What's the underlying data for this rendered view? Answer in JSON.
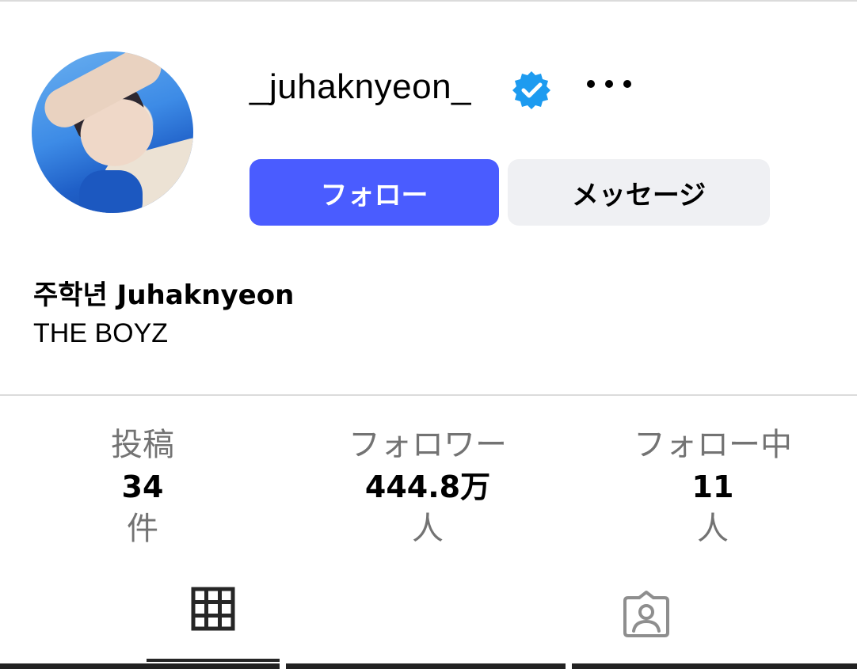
{
  "profile": {
    "username": "_juhaknyeon_",
    "display_name": "주학년 Juhaknyeon",
    "bio": "THE BOYZ"
  },
  "icons": {
    "verified": "verified-badge-icon",
    "more": "more-options-icon",
    "grid": "grid-icon",
    "tagged": "tagged-icon"
  },
  "actions": {
    "follow_label": "フォロー",
    "message_label": "メッセージ"
  },
  "stats": [
    {
      "label": "投稿",
      "value": "34",
      "unit": "件"
    },
    {
      "label": "フォロワー",
      "value": "444.8万",
      "unit": "人"
    },
    {
      "label": "フォロー中",
      "value": "11",
      "unit": "人"
    }
  ],
  "colors": {
    "follow_button": "#4a5cff",
    "message_button": "#eff0f3",
    "verified": "#1d9bf0"
  }
}
